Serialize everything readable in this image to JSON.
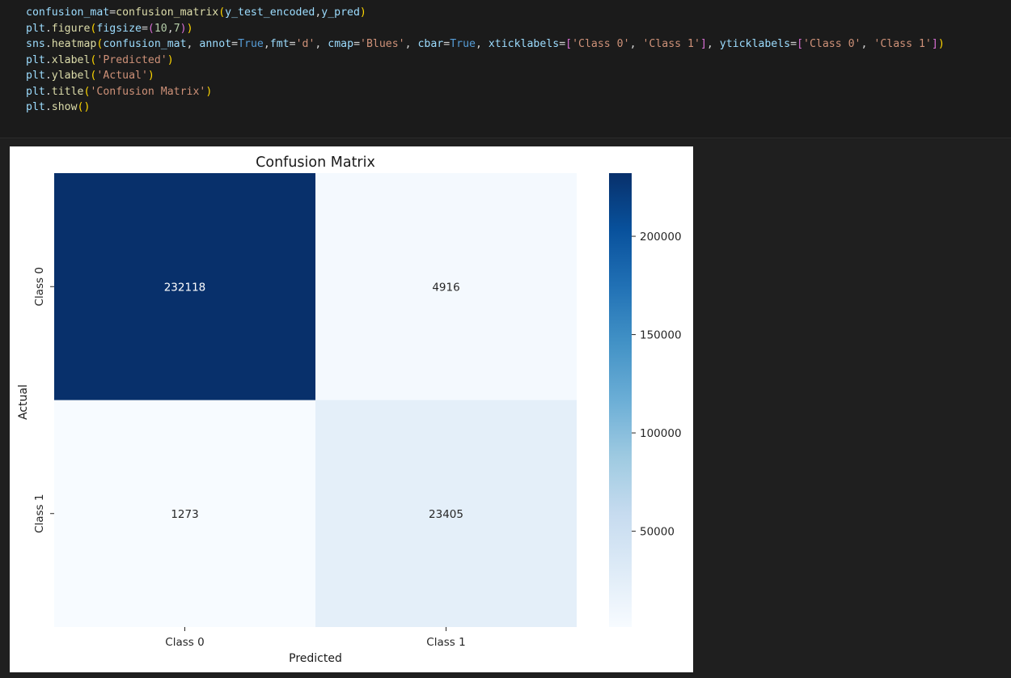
{
  "code_cell": {
    "lines": [
      [
        [
          "confusion_mat",
          "var"
        ],
        [
          "=",
          "op"
        ],
        [
          "confusion_matrix",
          "fn"
        ],
        [
          "(",
          "p1"
        ],
        [
          "y_test_encoded",
          "var"
        ],
        [
          ",",
          "op"
        ],
        [
          "y_pred",
          "var"
        ],
        [
          ")",
          "p1"
        ]
      ],
      [
        [
          "plt",
          "var"
        ],
        [
          ".",
          "op"
        ],
        [
          "figure",
          "fn"
        ],
        [
          "(",
          "p1"
        ],
        [
          "figsize",
          "var"
        ],
        [
          "=",
          "op"
        ],
        [
          "(",
          "p2"
        ],
        [
          "10",
          "num"
        ],
        [
          ",",
          "op"
        ],
        [
          "7",
          "num"
        ],
        [
          ")",
          "p2"
        ],
        [
          ")",
          "p1"
        ]
      ],
      [
        [
          "sns",
          "var"
        ],
        [
          ".",
          "op"
        ],
        [
          "heatmap",
          "fn"
        ],
        [
          "(",
          "p1"
        ],
        [
          "confusion_mat",
          "var"
        ],
        [
          ", ",
          "op"
        ],
        [
          "annot",
          "var"
        ],
        [
          "=",
          "op"
        ],
        [
          "True",
          "kw"
        ],
        [
          ",",
          "op"
        ],
        [
          "fmt",
          "var"
        ],
        [
          "=",
          "op"
        ],
        [
          "'d'",
          "str"
        ],
        [
          ", ",
          "op"
        ],
        [
          "cmap",
          "var"
        ],
        [
          "=",
          "op"
        ],
        [
          "'Blues'",
          "str"
        ],
        [
          ", ",
          "op"
        ],
        [
          "cbar",
          "var"
        ],
        [
          "=",
          "op"
        ],
        [
          "True",
          "kw"
        ],
        [
          ", ",
          "op"
        ],
        [
          "xticklabels",
          "var"
        ],
        [
          "=",
          "op"
        ],
        [
          "[",
          "p2"
        ],
        [
          "'Class 0'",
          "str"
        ],
        [
          ", ",
          "op"
        ],
        [
          "'Class 1'",
          "str"
        ],
        [
          "]",
          "p2"
        ],
        [
          ", ",
          "op"
        ],
        [
          "yticklabels",
          "var"
        ],
        [
          "=",
          "op"
        ],
        [
          "[",
          "p2"
        ],
        [
          "'Class 0'",
          "str"
        ],
        [
          ", ",
          "op"
        ],
        [
          "'Class 1'",
          "str"
        ],
        [
          "]",
          "p2"
        ],
        [
          ")",
          "p1"
        ]
      ],
      [
        [
          "plt",
          "var"
        ],
        [
          ".",
          "op"
        ],
        [
          "xlabel",
          "fn"
        ],
        [
          "(",
          "p1"
        ],
        [
          "'Predicted'",
          "str"
        ],
        [
          ")",
          "p1"
        ]
      ],
      [
        [
          "plt",
          "var"
        ],
        [
          ".",
          "op"
        ],
        [
          "ylabel",
          "fn"
        ],
        [
          "(",
          "p1"
        ],
        [
          "'Actual'",
          "str"
        ],
        [
          ")",
          "p1"
        ]
      ],
      [
        [
          "plt",
          "var"
        ],
        [
          ".",
          "op"
        ],
        [
          "title",
          "fn"
        ],
        [
          "(",
          "p1"
        ],
        [
          "'Confusion Matrix'",
          "str"
        ],
        [
          ")",
          "p1"
        ]
      ],
      [
        [
          "plt",
          "var"
        ],
        [
          ".",
          "op"
        ],
        [
          "show",
          "fn"
        ],
        [
          "(",
          "p1"
        ],
        [
          ")",
          "p1"
        ]
      ]
    ]
  },
  "chart_data": {
    "type": "heatmap",
    "title": "Confusion Matrix",
    "xlabel": "Predicted",
    "ylabel": "Actual",
    "x_categories": [
      "Class 0",
      "Class 1"
    ],
    "y_categories": [
      "Class 0",
      "Class 1"
    ],
    "values": [
      [
        232118,
        4916
      ],
      [
        1273,
        23405
      ]
    ],
    "colormap": "Blues",
    "colorbar": {
      "ticks": [
        50000,
        100000,
        150000,
        200000
      ],
      "range": [
        1273,
        232118
      ]
    }
  }
}
